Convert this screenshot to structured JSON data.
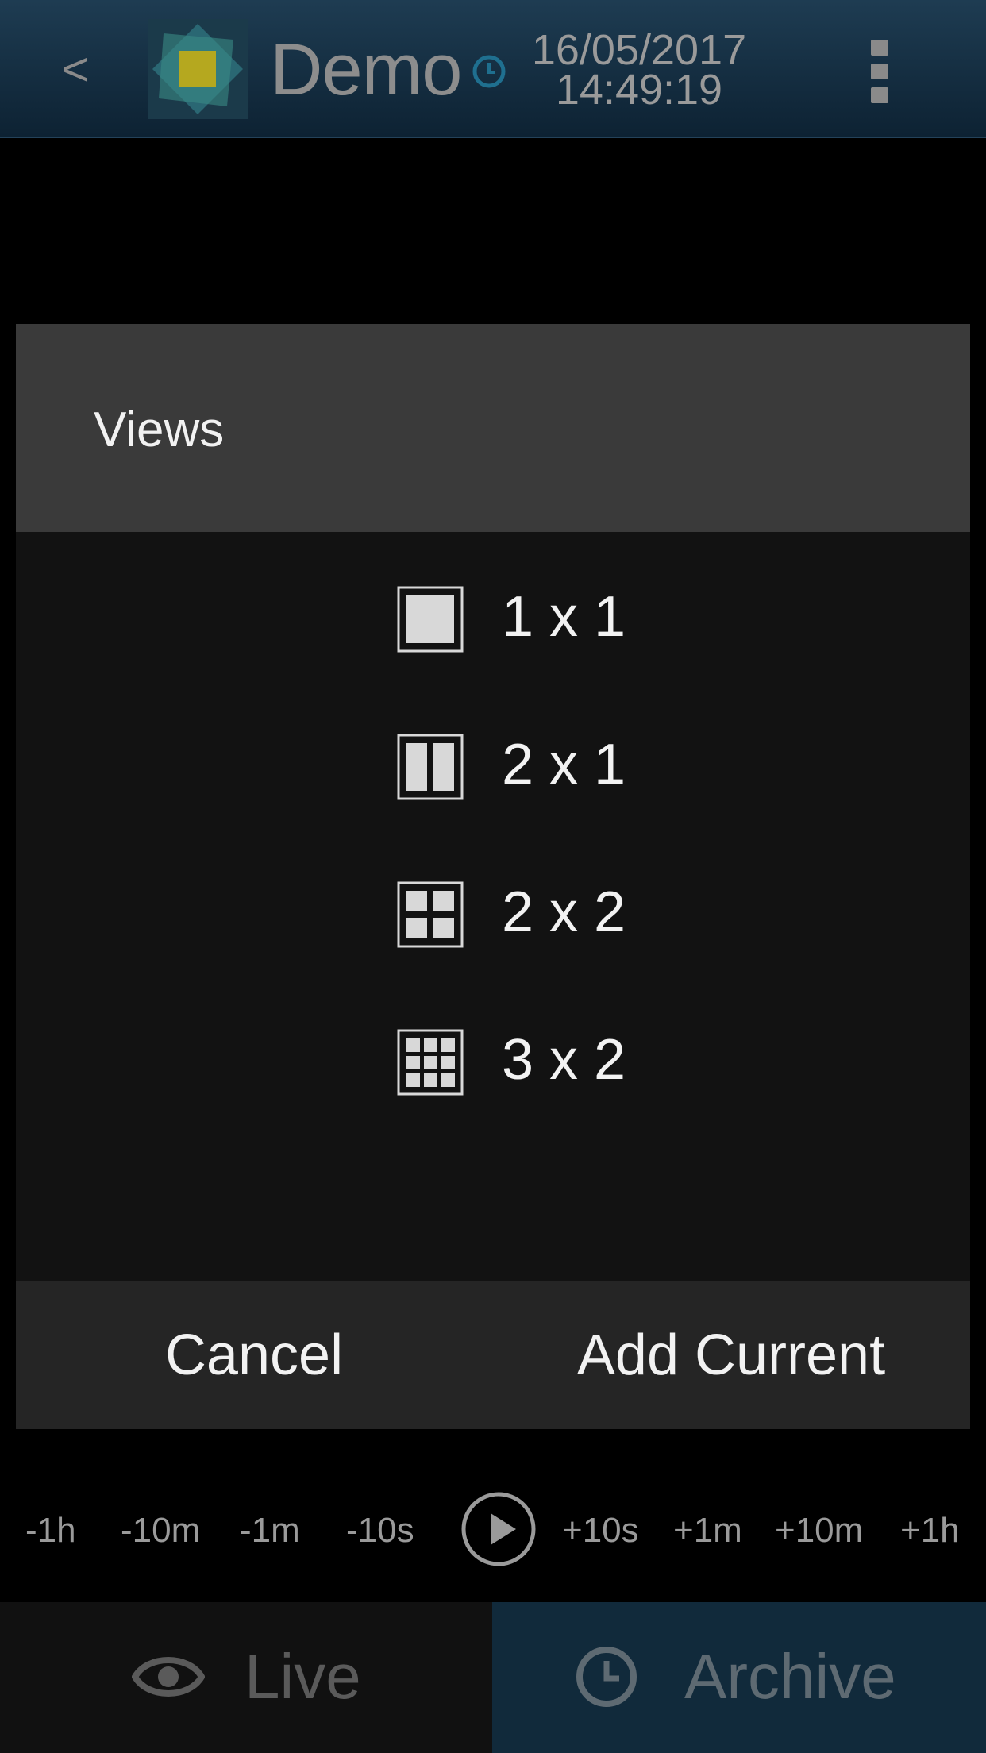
{
  "header": {
    "back_label": "<",
    "title": "Demo",
    "date": "16/05/2017",
    "time": "14:49:19",
    "icons": {
      "back": "chevron-left-icon",
      "logo": "app-logo",
      "clock": "clock-icon",
      "menu": "kebab-menu-icon"
    }
  },
  "dialog": {
    "title": "Views",
    "views": [
      {
        "label": "1 x 1",
        "icon": "layout-1x1-icon"
      },
      {
        "label": "2 x 1",
        "icon": "layout-2x1-icon"
      },
      {
        "label": "2 x 2",
        "icon": "layout-2x2-icon"
      },
      {
        "label": "3 x 2",
        "icon": "layout-3x2-icon"
      }
    ],
    "cancel_label": "Cancel",
    "add_label": "Add Current"
  },
  "timeline": {
    "back_steps": [
      "-1h",
      "-10m",
      "-1m",
      "-10s"
    ],
    "forward_steps": [
      "+10s",
      "+1m",
      "+10m",
      "+1h"
    ],
    "play_icon": "play-icon"
  },
  "tabs": {
    "live_label": "Live",
    "archive_label": "Archive",
    "live_icon": "eye-icon",
    "archive_icon": "clock-icon",
    "active": "archive"
  },
  "colors": {
    "header_bg": "#1e3c52",
    "dialog_header_bg": "#3a3a3a",
    "dialog_body_bg": "#121212",
    "dialog_footer_bg": "#252525",
    "archive_tab_bg": "#112a3b",
    "logo_accent": "#b5a81f"
  }
}
